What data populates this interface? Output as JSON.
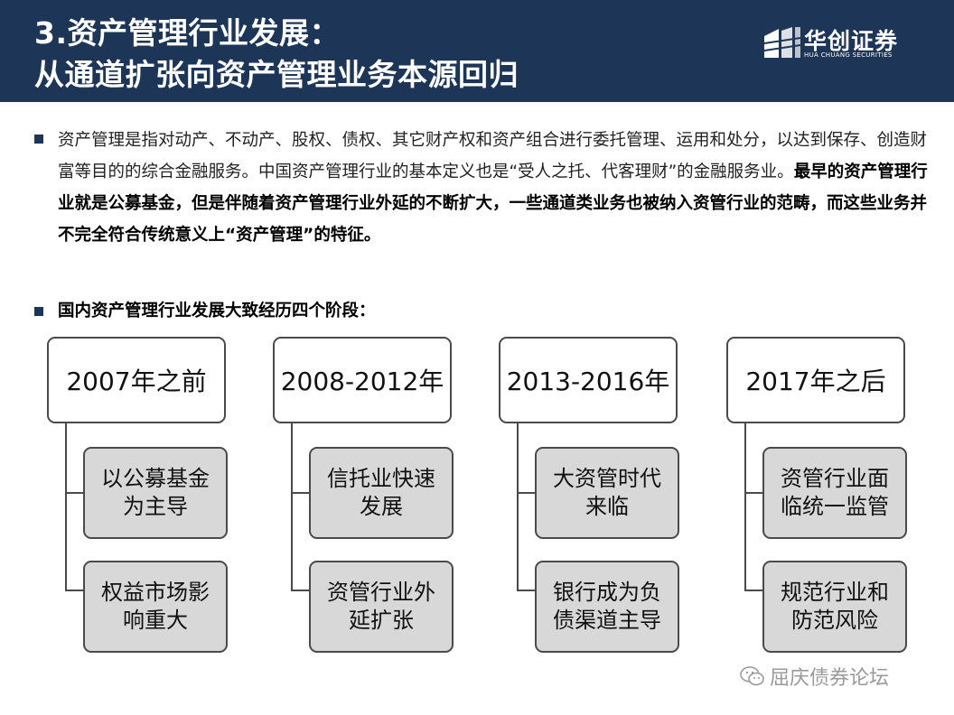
{
  "header": {
    "title_line1": "3.资产管理行业发展：",
    "title_line2": "从通道扩张向资产管理业务本源回归",
    "logo_cn": "华创证券",
    "logo_en": "HUA CHUANG SECURITIES"
  },
  "intro": {
    "normal": "资产管理是指对动产、不动产、股权、债权、其它财产权和资产组合进行委托管理、运用和处分，以达到保存、创造财富等目的的综合金融服务。中国资产管理行业的基本定义也是“受人之托、代客理财”的金融服务业。",
    "bold": "最早的资产管理行业就是公募基金，但是伴随着资产管理行业外延的不断扩大，一些通道类业务也被纳入资管行业的范畴，而这些业务并不完全符合传统意义上“资产管理”的特征。"
  },
  "stages_heading": "国内资产管理行业发展大致经历四个阶段：",
  "stages": [
    {
      "period": "2007年之前",
      "items": [
        "以公募基金为主导",
        "权益市场影响重大"
      ]
    },
    {
      "period": "2008-2012年",
      "items": [
        "信托业快速发展",
        "资管行业外延扩张"
      ]
    },
    {
      "period": "2013-2016年",
      "items": [
        "大资管时代来临",
        "银行成为负债渠道主导"
      ]
    },
    {
      "period": "2017年之后",
      "items": [
        "资管行业面临统一监管",
        "规范行业和防范风险"
      ]
    }
  ],
  "watermark": "屈庆债券论坛",
  "colors": {
    "header_bg": "#1d3557",
    "box_fill": "#d8d8d8",
    "border": "#4a4a4a"
  }
}
